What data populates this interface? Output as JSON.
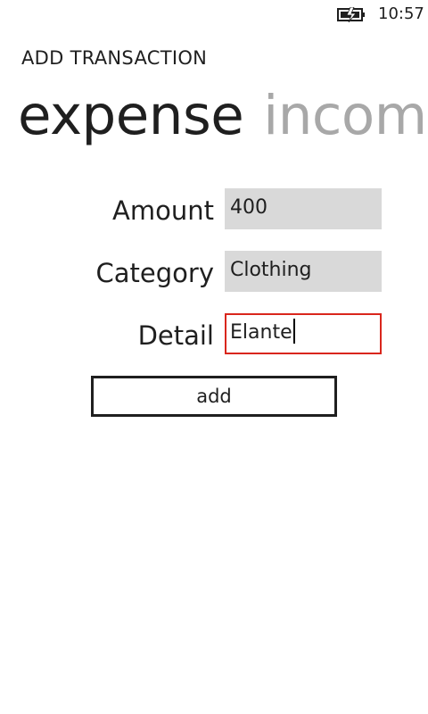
{
  "status_bar": {
    "time": "10:57",
    "battery_icon": "battery-charging-icon"
  },
  "app": {
    "title": "ADD TRANSACTION"
  },
  "pivot": {
    "items": [
      {
        "label": "expense",
        "selected": true
      },
      {
        "label": "income",
        "selected": false
      }
    ]
  },
  "form": {
    "amount": {
      "label": "Amount",
      "value": "400"
    },
    "category": {
      "label": "Category",
      "value": "Clothing"
    },
    "detail": {
      "label": "Detail",
      "value": "Elante"
    },
    "add_button": "add"
  },
  "colors": {
    "field_background": "#d9d9d9",
    "focus_border": "#d9261c",
    "inactive_pivot": "#a8a8a8",
    "text": "#1f1f1f"
  }
}
